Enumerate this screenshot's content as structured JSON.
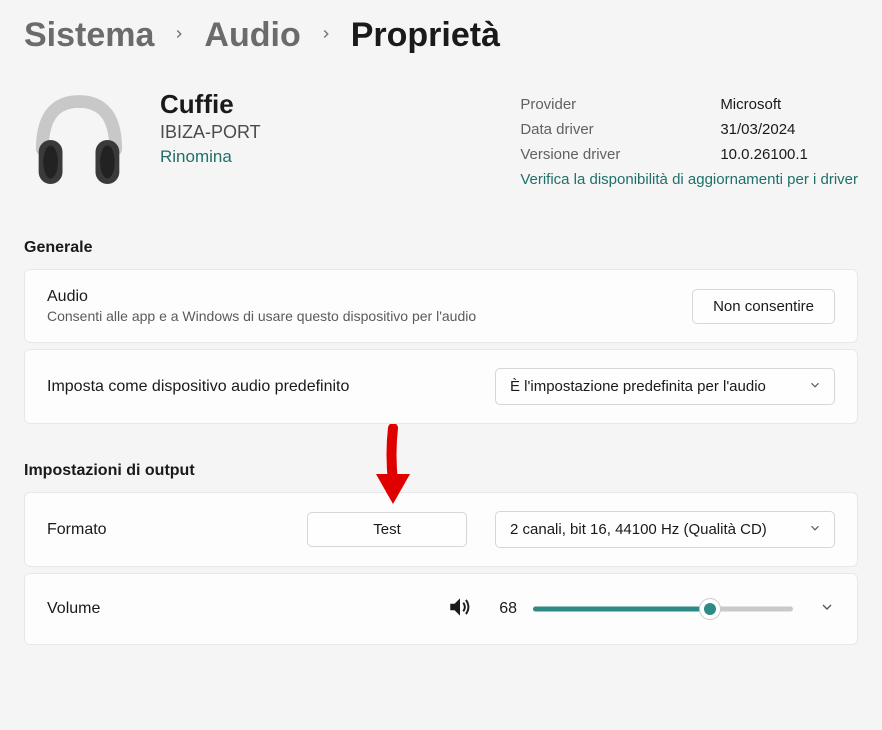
{
  "breadcrumb": {
    "items": [
      "Sistema",
      "Audio",
      "Proprietà"
    ]
  },
  "device": {
    "name": "Cuffie",
    "subname": "IBIZA-PORT",
    "rename_label": "Rinomina"
  },
  "driver_info": {
    "provider_label": "Provider",
    "provider_value": "Microsoft",
    "date_label": "Data driver",
    "date_value": "31/03/2024",
    "version_label": "Versione driver",
    "version_value": "10.0.26100.1",
    "update_link": "Verifica la disponibilità di aggiornamenti per i driver"
  },
  "sections": {
    "general_title": "Generale",
    "output_title": "Impostazioni di output"
  },
  "audio_card": {
    "title": "Audio",
    "subtitle": "Consenti alle app e a Windows di usare questo dispositivo per l'audio",
    "button_label": "Non consentire"
  },
  "default_card": {
    "title": "Imposta come dispositivo audio predefinito",
    "select_value": "È l'impostazione predefinita per l'audio"
  },
  "format_card": {
    "title": "Formato",
    "test_button": "Test",
    "select_value": "2 canali, bit 16, 44100 Hz (Qualità CD)"
  },
  "volume_card": {
    "title": "Volume",
    "value": "68",
    "percent": 68
  }
}
